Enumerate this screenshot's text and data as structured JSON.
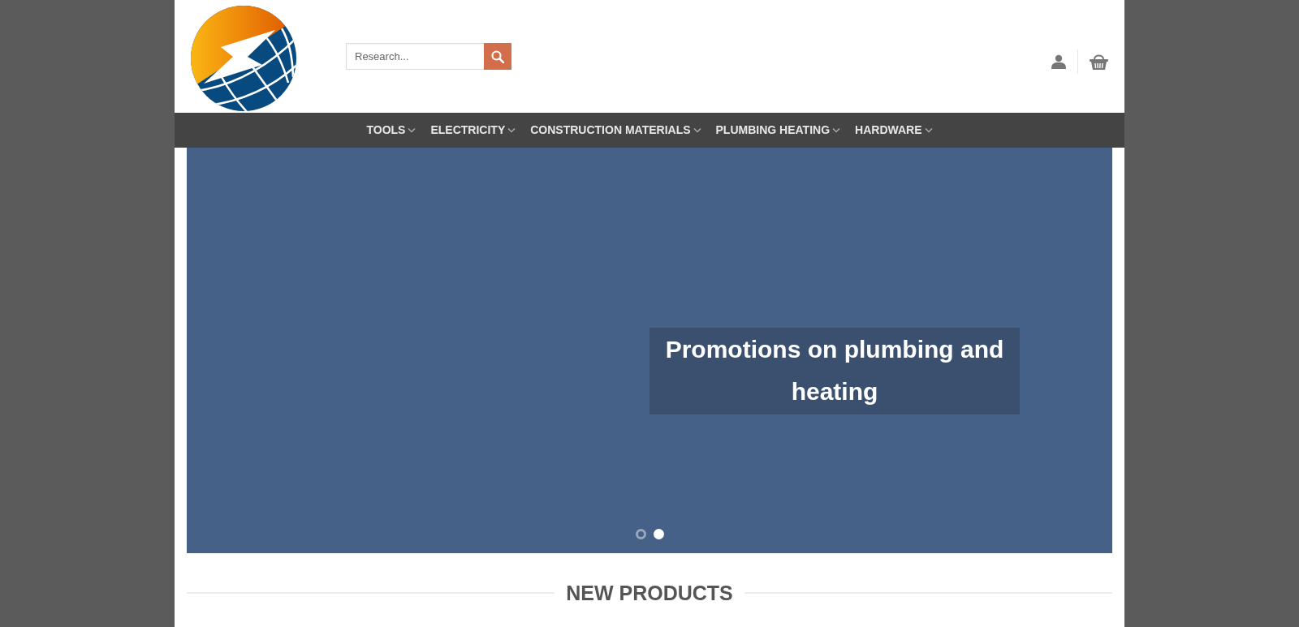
{
  "header": {
    "search": {
      "placeholder": "Research..."
    }
  },
  "nav": {
    "items": [
      {
        "label": "TOOLS"
      },
      {
        "label": "ELECTRICITY"
      },
      {
        "label": "CONSTRUCTION MATERIALS"
      },
      {
        "label": "PLUMBING HEATING"
      },
      {
        "label": "HARDWARE"
      }
    ]
  },
  "slider": {
    "caption": "Promotions on plumbing and heating",
    "dots": [
      {
        "selected": false
      },
      {
        "selected": true
      }
    ]
  },
  "section": {
    "title": "NEW PRODUCTS"
  }
}
